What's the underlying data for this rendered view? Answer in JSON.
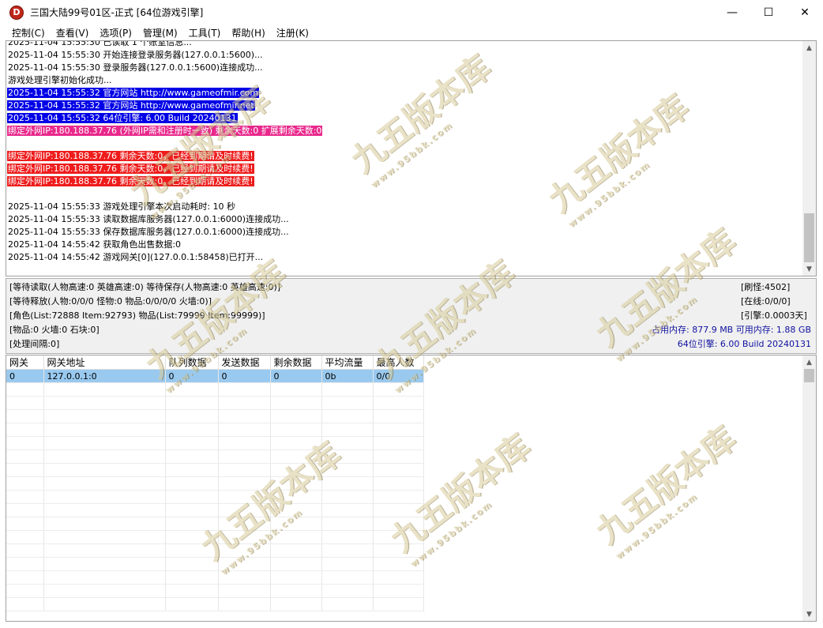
{
  "window": {
    "title": "三国大陆99号01区-正式 [64位游戏引擎]",
    "icon_letter": "D",
    "controls": [
      "—",
      "☐",
      "✕"
    ]
  },
  "menu": [
    "控制(C)",
    "查看(V)",
    "选项(P)",
    "管理(M)",
    "工具(T)",
    "帮助(H)",
    "注册(K)"
  ],
  "log": [
    {
      "text": "2025-11-04 15:55:30 已读取 1 个账室信息...",
      "style": "plain"
    },
    {
      "text": "2025-11-04 15:55:30 开始连接登录服务器(127.0.0.1:5600)...",
      "style": "plain"
    },
    {
      "text": "2025-11-04 15:55:30 登录服务器(127.0.0.1:5600)连接成功...",
      "style": "plain"
    },
    {
      "text": "游戏处理引擎初始化成功...",
      "style": "plain"
    },
    {
      "text": "2025-11-04 15:55:32 官方网站 http://www.gameofmir.com",
      "style": "hl-blue"
    },
    {
      "text": "2025-11-04 15:55:32 官方网站 http://www.gameofmir.net",
      "style": "hl-blue"
    },
    {
      "text": "2025-11-04 15:55:32 64位引擎: 6.00 Build 20240131",
      "style": "hl-blue"
    },
    {
      "text": "绑定外网IP:180.188.37.76 (外网IP需和注册时一致) 剩余天数:0 扩展剩余天数:0",
      "style": "hl-pink"
    },
    {
      "text": "",
      "style": "plain"
    },
    {
      "text": "绑定外网IP:180.188.37.76 剩余天数:0，已经到期请及时续费!",
      "style": "hl-red"
    },
    {
      "text": "绑定外网IP:180.188.37.76 剩余天数:0，已经到期请及时续费!",
      "style": "hl-red"
    },
    {
      "text": "绑定外网IP:180.188.37.76 剩余天数:0，已经到期请及时续费!",
      "style": "hl-red"
    },
    {
      "text": "",
      "style": "plain"
    },
    {
      "text": "2025-11-04 15:55:33 游戏处理引擎本次启动耗时: 10 秒",
      "style": "plain"
    },
    {
      "text": "2025-11-04 15:55:33 读取数据库服务器(127.0.0.1:6000)连接成功...",
      "style": "plain"
    },
    {
      "text": "2025-11-04 15:55:33 保存数据库服务器(127.0.0.1:6000)连接成功...",
      "style": "plain"
    },
    {
      "text": "2025-11-04 14:55:42 获取角色出售数据:0",
      "style": "plain"
    },
    {
      "text": "2025-11-04 14:55:42 游戏网关[0](127.0.0.1:58458)已打开...",
      "style": "plain"
    }
  ],
  "status": {
    "line1": "[等待读取(人物高速:0 英雄高速:0) 等待保存(人物高速:0 英雄高速:0)]",
    "line2": "[等待释放(人物:0/0/0 怪物:0 物品:0/0/0/0 火墙:0)]",
    "line3": "[角色(List:72888 Item:92793) 物品(List:79999 Item:99999)]",
    "line4": "[物品:0 火墙:0 石块:0]",
    "line5": "[处理间隔:0]",
    "refresh": "[刷怪:4502]",
    "online": "[在线:0/0/0]",
    "engine_time": "[引擎:0.0003天]",
    "memory": "占用内存: 877.9 MB 可用内存: 1.88 GB",
    "engine_version": "64位引擎: 6.00 Build 20240131"
  },
  "gateway_table": {
    "columns": [
      "网关",
      "网关地址",
      "队列数据",
      "发送数据",
      "剩余数据",
      "平均流量",
      "最高人数"
    ],
    "rows": [
      [
        "0",
        "127.0.0.1:0",
        "0",
        "0",
        "0",
        "0b",
        "0/0"
      ]
    ]
  },
  "watermark": {
    "text": "九五版本库",
    "url": "www.95bbk.com"
  }
}
